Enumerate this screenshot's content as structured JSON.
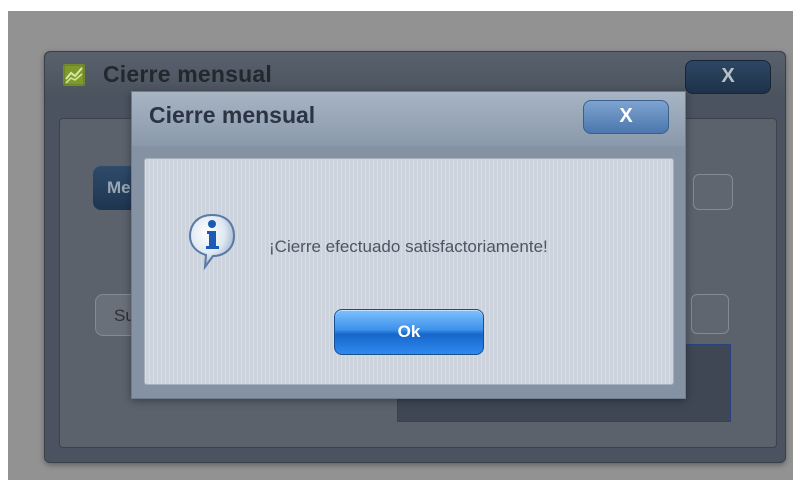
{
  "background_window": {
    "title": "Cierre mensual",
    "close_label": "X",
    "icon": "chart-icon",
    "mes_button_label": "Me",
    "su_button_label": "Su"
  },
  "dialog": {
    "title": "Cierre mensual",
    "close_label": "X",
    "icon": "info-icon",
    "message": "¡Cierre efectuado satisfactoriamente!",
    "ok_label": "Ok"
  },
  "colors": {
    "ok_button": "#2f8af0",
    "dialog_title_bar": "#9aa9bb",
    "dialog_body": "#ccd3dc",
    "overlay": "#929292"
  }
}
